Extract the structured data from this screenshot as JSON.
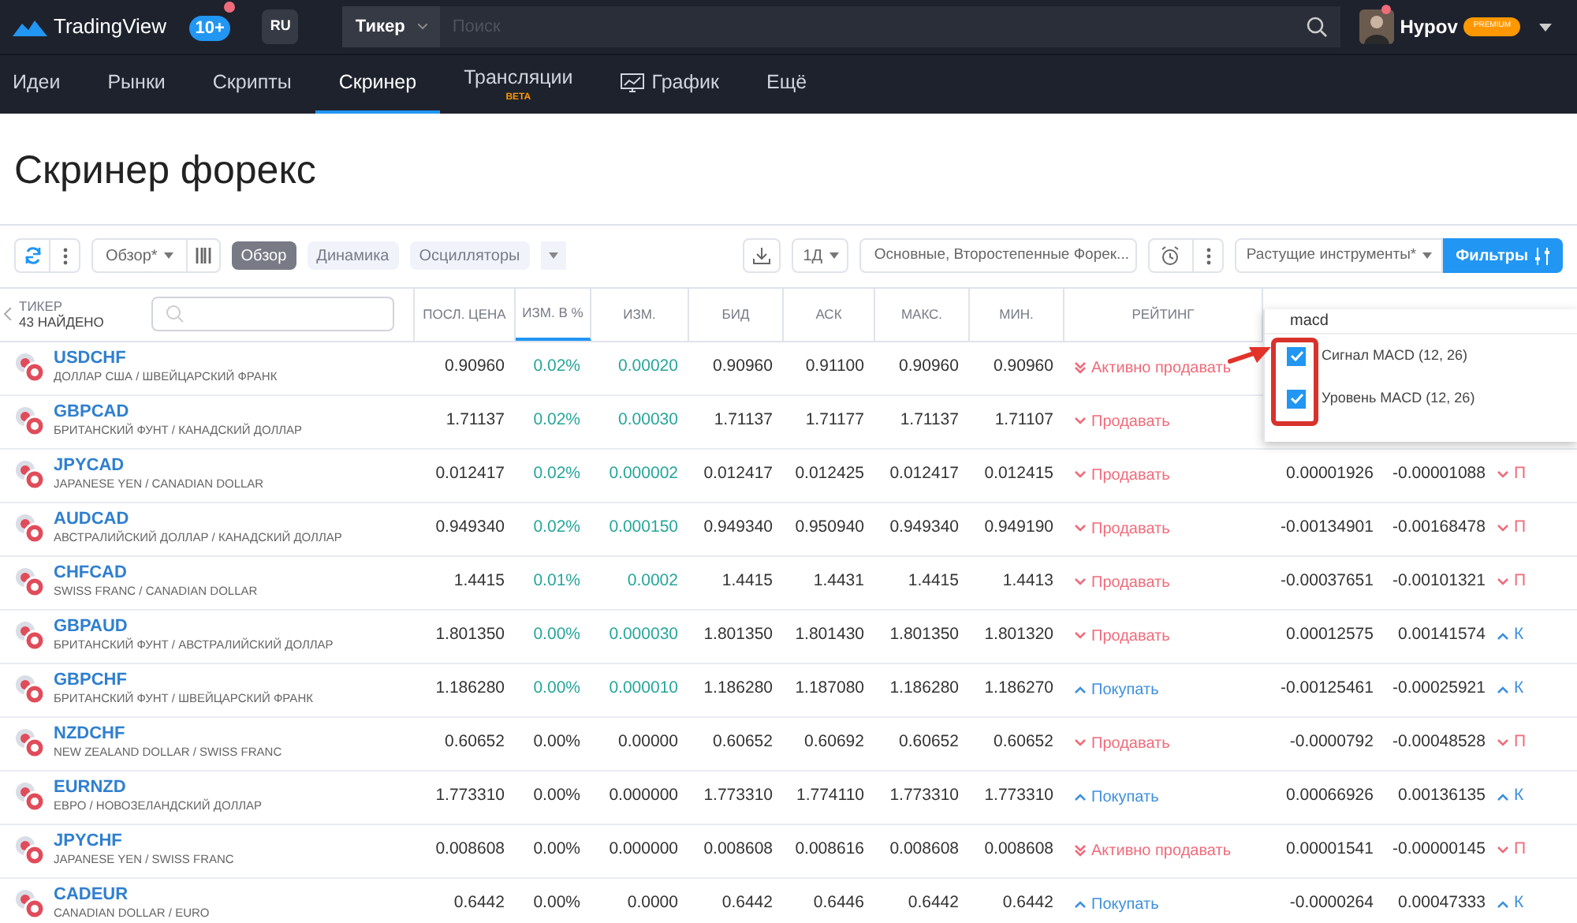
{
  "topbar": {
    "logo": "TradingView",
    "notifications": "10+",
    "language": "RU",
    "search_scope": "Тикер",
    "search_placeholder": "Поиск",
    "user": "Hypov",
    "plan": "PREMIUM"
  },
  "nav": [
    {
      "label": "Идеи",
      "selected": false
    },
    {
      "label": "Рынки",
      "selected": false
    },
    {
      "label": "Скрипты",
      "selected": false
    },
    {
      "label": "Скринер",
      "selected": true
    },
    {
      "label": "Трансляции",
      "selected": false,
      "badge": "BETA"
    },
    {
      "label": "График",
      "selected": false,
      "kind": "chart"
    },
    {
      "label": "Ещё",
      "selected": false
    }
  ],
  "title": "Скринер форекс",
  "toolbar": {
    "preset": "Обзор*",
    "tabs": [
      {
        "label": "Обзор",
        "selected": true
      },
      {
        "label": "Динамика",
        "selected": false
      },
      {
        "label": "Осцилляторы",
        "selected": false
      }
    ],
    "interval": "1Д",
    "markets": "Основные, Второстепенные Форек...",
    "filter_preset": "Растущие инструменты*",
    "filters_button": "Фильтры"
  },
  "table": {
    "ticker_header": "ТИКЕР",
    "found": "43 НАЙДЕНО",
    "columns": [
      {
        "label": "ПОСЛ. ЦЕНА",
        "selected": false
      },
      {
        "label": "ИЗМ. В %",
        "selected": true
      },
      {
        "label": "ИЗМ.",
        "selected": false
      },
      {
        "label": "БИД",
        "selected": false
      },
      {
        "label": "АСК",
        "selected": false
      },
      {
        "label": "МАКС.",
        "selected": false
      },
      {
        "label": "МИН.",
        "selected": false
      },
      {
        "label": "РЕЙТИНГ",
        "selected": false
      }
    ],
    "rows": [
      {
        "symbol": "USDCHF",
        "name": "ДОЛЛАР США / ШВЕЙЦАРСКИЙ ФРАНК",
        "last": "0.90960",
        "change_up": true,
        "change_pct": "0.02%",
        "change": "0.00020",
        "bid": "0.90960",
        "ask": "0.91100",
        "high": "0.90960",
        "low": "0.90960",
        "rating": {
          "kind": "strong_sell",
          "label": "Активно продавать"
        }
      },
      {
        "symbol": "GBPCAD",
        "name": "БРИТАНСКИЙ ФУНТ / КАНАДСКИЙ ДОЛЛАР",
        "last": "1.71137",
        "change_up": true,
        "change_pct": "0.02%",
        "change": "0.00030",
        "bid": "1.71137",
        "ask": "1.71177",
        "high": "1.71137",
        "low": "1.71107",
        "rating": {
          "kind": "sell",
          "label": "Продавать"
        }
      },
      {
        "symbol": "JPYCAD",
        "name": "JAPANESE YEN / CANADIAN DOLLAR",
        "last": "0.012417",
        "change_up": true,
        "change_pct": "0.02%",
        "change": "0.000002",
        "bid": "0.012417",
        "ask": "0.012425",
        "high": "0.012417",
        "low": "0.012415",
        "rating": {
          "kind": "sell",
          "label": "Продавать"
        },
        "macd_signal": "0.00001926",
        "macd_level": "-0.00001088",
        "rating_2": {
          "kind": "sell",
          "label": "П"
        }
      },
      {
        "symbol": "AUDCAD",
        "name": "АВСТРАЛИЙСКИЙ ДОЛЛАР / КАНАДСКИЙ ДОЛЛАР",
        "last": "0.949340",
        "change_up": true,
        "change_pct": "0.02%",
        "change": "0.000150",
        "bid": "0.949340",
        "ask": "0.950940",
        "high": "0.949340",
        "low": "0.949190",
        "rating": {
          "kind": "sell",
          "label": "Продавать"
        },
        "macd_signal": "-0.00134901",
        "macd_level": "-0.00168478",
        "rating_2": {
          "kind": "sell",
          "label": "П"
        }
      },
      {
        "symbol": "CHFCAD",
        "name": "SWISS FRANC / CANADIAN DOLLAR",
        "last": "1.4415",
        "change_up": true,
        "change_pct": "0.01%",
        "change": "0.0002",
        "bid": "1.4415",
        "ask": "1.4431",
        "high": "1.4415",
        "low": "1.4413",
        "rating": {
          "kind": "sell",
          "label": "Продавать"
        },
        "macd_signal": "-0.00037651",
        "macd_level": "-0.00101321",
        "rating_2": {
          "kind": "sell",
          "label": "П"
        }
      },
      {
        "symbol": "GBPAUD",
        "name": "БРИТАНСКИЙ ФУНТ / АВСТРАЛИЙСКИЙ ДОЛЛАР",
        "last": "1.801350",
        "change_up": true,
        "change_pct": "0.00%",
        "change": "0.000030",
        "bid": "1.801350",
        "ask": "1.801430",
        "high": "1.801350",
        "low": "1.801320",
        "rating": {
          "kind": "sell",
          "label": "Продавать"
        },
        "macd_signal": "0.00012575",
        "macd_level": "0.00141574",
        "rating_2": {
          "kind": "buy",
          "label": "К"
        }
      },
      {
        "symbol": "GBPCHF",
        "name": "БРИТАНСКИЙ ФУНТ / ШВЕЙЦАРСКИЙ ФРАНК",
        "last": "1.186280",
        "change_up": true,
        "change_pct": "0.00%",
        "change": "0.000010",
        "bid": "1.186280",
        "ask": "1.187080",
        "high": "1.186280",
        "low": "1.186270",
        "rating": {
          "kind": "buy",
          "label": "Покупать"
        },
        "macd_signal": "-0.00125461",
        "macd_level": "-0.00025921",
        "rating_2": {
          "kind": "buy",
          "label": "К"
        }
      },
      {
        "symbol": "NZDCHF",
        "name": "NEW ZEALAND DOLLAR / SWISS FRANC",
        "last": "0.60652",
        "change_up": false,
        "change_pct": "0.00%",
        "change": "0.00000",
        "bid": "0.60652",
        "ask": "0.60692",
        "high": "0.60652",
        "low": "0.60652",
        "rating": {
          "kind": "sell",
          "label": "Продавать"
        },
        "macd_signal": "-0.0000792",
        "macd_level": "-0.00048528",
        "rating_2": {
          "kind": "sell",
          "label": "П"
        }
      },
      {
        "symbol": "EURNZD",
        "name": "ЕВРО / НОВОЗЕЛАНДСКИЙ ДОЛЛАР",
        "last": "1.773310",
        "change_up": false,
        "change_pct": "0.00%",
        "change": "0.000000",
        "bid": "1.773310",
        "ask": "1.774110",
        "high": "1.773310",
        "low": "1.773310",
        "rating": {
          "kind": "buy",
          "label": "Покупать"
        },
        "macd_signal": "0.00066926",
        "macd_level": "0.00136135",
        "rating_2": {
          "kind": "buy",
          "label": "К"
        }
      },
      {
        "symbol": "JPYCHF",
        "name": "JAPANESE YEN / SWISS FRANC",
        "last": "0.008608",
        "change_up": false,
        "change_pct": "0.00%",
        "change": "0.000000",
        "bid": "0.008608",
        "ask": "0.008616",
        "high": "0.008608",
        "low": "0.008608",
        "rating": {
          "kind": "strong_sell",
          "label": "Активно продавать"
        },
        "macd_signal": "0.00001541",
        "macd_level": "-0.00000145",
        "rating_2": {
          "kind": "sell",
          "label": "П"
        }
      },
      {
        "symbol": "CADEUR",
        "name": "CANADIAN DOLLAR / EURO",
        "last": "0.6442",
        "change_up": false,
        "change_pct": "0.00%",
        "change": "0.0000",
        "bid": "0.6442",
        "ask": "0.6446",
        "high": "0.6442",
        "low": "0.6442",
        "rating": {
          "kind": "buy",
          "label": "Покупать"
        },
        "macd_signal": "-0.0000264",
        "macd_level": "0.00047333",
        "rating_2": {
          "kind": "buy",
          "label": "К"
        }
      }
    ]
  },
  "column_picker": {
    "query": "macd",
    "options": [
      {
        "label": "Сигнал MACD (12, 26)",
        "checked": true
      },
      {
        "label": "Уровень MACD (12, 26)",
        "checked": true
      }
    ]
  }
}
